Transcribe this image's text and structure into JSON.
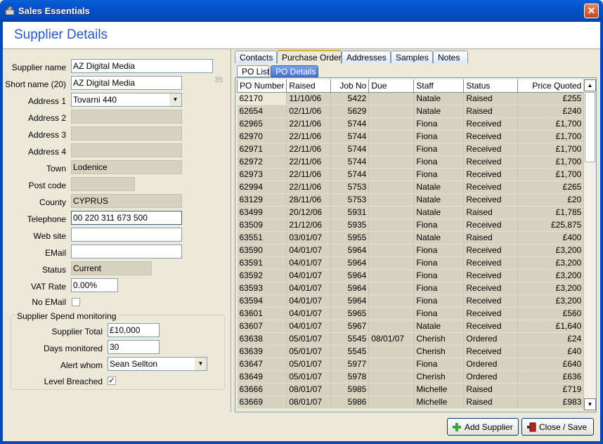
{
  "window": {
    "title": "Sales Essentials",
    "close": "✕"
  },
  "header": {
    "title": "Supplier Details"
  },
  "form": {
    "supplier_name": {
      "label": "Supplier name",
      "value": "AZ Digital Media"
    },
    "short_name": {
      "label": "Short name (20)",
      "value": "AZ Digital Media",
      "count": "35"
    },
    "address1": {
      "label": "Address 1",
      "value": "Tovarni 440"
    },
    "address2": {
      "label": "Address 2",
      "value": ""
    },
    "address3": {
      "label": "Address 3",
      "value": ""
    },
    "address4": {
      "label": "Address 4",
      "value": ""
    },
    "town": {
      "label": "Town",
      "value": "Lodenice"
    },
    "postcode": {
      "label": "Post code",
      "value": ""
    },
    "county": {
      "label": "County",
      "value": "CYPRUS"
    },
    "telephone": {
      "label": "Telephone",
      "value": "00 220 311 673 500"
    },
    "website": {
      "label": "Web site",
      "value": ""
    },
    "email": {
      "label": "EMail",
      "value": ""
    },
    "status": {
      "label": "Status",
      "value": "Current"
    },
    "vat_rate": {
      "label": "VAT Rate",
      "value": "0.00%"
    },
    "no_email": {
      "label": "No EMail",
      "checked": false
    }
  },
  "monitoring": {
    "title": "Supplier Spend monitoring",
    "supplier_total": {
      "label": "Supplier Total",
      "value": "£10,000"
    },
    "days_monitored": {
      "label": "Days monitored",
      "value": "30"
    },
    "alert_whom": {
      "label": "Alert whom",
      "value": "Sean Sellton"
    },
    "level_breached": {
      "label": "Level Breached",
      "checked": true,
      "mark": "✓"
    }
  },
  "tabs": [
    "Contacts",
    "Purchase Orders",
    "Addresses",
    "Samples",
    "Notes"
  ],
  "subtabs": [
    "PO List",
    "PO Details"
  ],
  "grid": {
    "columns": [
      "PO Number",
      "Raised",
      "Job No",
      "Due",
      "Staff",
      "Status",
      "Price Quoted"
    ],
    "rows": [
      [
        "62170",
        "11/10/06",
        "5422",
        "",
        "Natale",
        "Raised",
        "£255"
      ],
      [
        "62654",
        "02/11/06",
        "5629",
        "",
        "Natale",
        "Raised",
        "£240"
      ],
      [
        "62965",
        "22/11/06",
        "5744",
        "",
        "Fiona",
        "Received",
        "£1,700"
      ],
      [
        "62970",
        "22/11/06",
        "5744",
        "",
        "Fiona",
        "Received",
        "£1,700"
      ],
      [
        "62971",
        "22/11/06",
        "5744",
        "",
        "Fiona",
        "Received",
        "£1,700"
      ],
      [
        "62972",
        "22/11/06",
        "5744",
        "",
        "Fiona",
        "Received",
        "£1,700"
      ],
      [
        "62973",
        "22/11/06",
        "5744",
        "",
        "Fiona",
        "Received",
        "£1,700"
      ],
      [
        "62994",
        "22/11/06",
        "5753",
        "",
        "Natale",
        "Received",
        "£265"
      ],
      [
        "63129",
        "28/11/06",
        "5753",
        "",
        "Natale",
        "Received",
        "£20"
      ],
      [
        "63499",
        "20/12/06",
        "5931",
        "",
        "Natale",
        "Raised",
        "£1,785"
      ],
      [
        "63509",
        "21/12/06",
        "5935",
        "",
        "Fiona",
        "Received",
        "£25,875"
      ],
      [
        "63551",
        "03/01/07",
        "5955",
        "",
        "Natale",
        "Raised",
        "£400"
      ],
      [
        "63590",
        "04/01/07",
        "5964",
        "",
        "Fiona",
        "Received",
        "£3,200"
      ],
      [
        "63591",
        "04/01/07",
        "5964",
        "",
        "Fiona",
        "Received",
        "£3,200"
      ],
      [
        "63592",
        "04/01/07",
        "5964",
        "",
        "Fiona",
        "Received",
        "£3,200"
      ],
      [
        "63593",
        "04/01/07",
        "5964",
        "",
        "Fiona",
        "Received",
        "£3,200"
      ],
      [
        "63594",
        "04/01/07",
        "5964",
        "",
        "Fiona",
        "Received",
        "£3,200"
      ],
      [
        "63601",
        "04/01/07",
        "5965",
        "",
        "Fiona",
        "Received",
        "£560"
      ],
      [
        "63607",
        "04/01/07",
        "5967",
        "",
        "Natale",
        "Received",
        "£1,640"
      ],
      [
        "63638",
        "05/01/07",
        "5545",
        "08/01/07",
        "Cherish",
        "Ordered",
        "£24"
      ],
      [
        "63639",
        "05/01/07",
        "5545",
        "",
        "Cherish",
        "Received",
        "£40"
      ],
      [
        "63647",
        "05/01/07",
        "5977",
        "",
        "Fiona",
        "Ordered",
        "£640"
      ],
      [
        "63649",
        "05/01/07",
        "5978",
        "",
        "Cherish",
        "Ordered",
        "£636"
      ],
      [
        "63666",
        "08/01/07",
        "5985",
        "",
        "Michelle",
        "Raised",
        "£719"
      ],
      [
        "63669",
        "08/01/07",
        "5986",
        "",
        "Michelle",
        "Raised",
        "£983"
      ]
    ]
  },
  "buttons": {
    "add_supplier": "Add Supplier",
    "close_save": "Close / Save"
  }
}
